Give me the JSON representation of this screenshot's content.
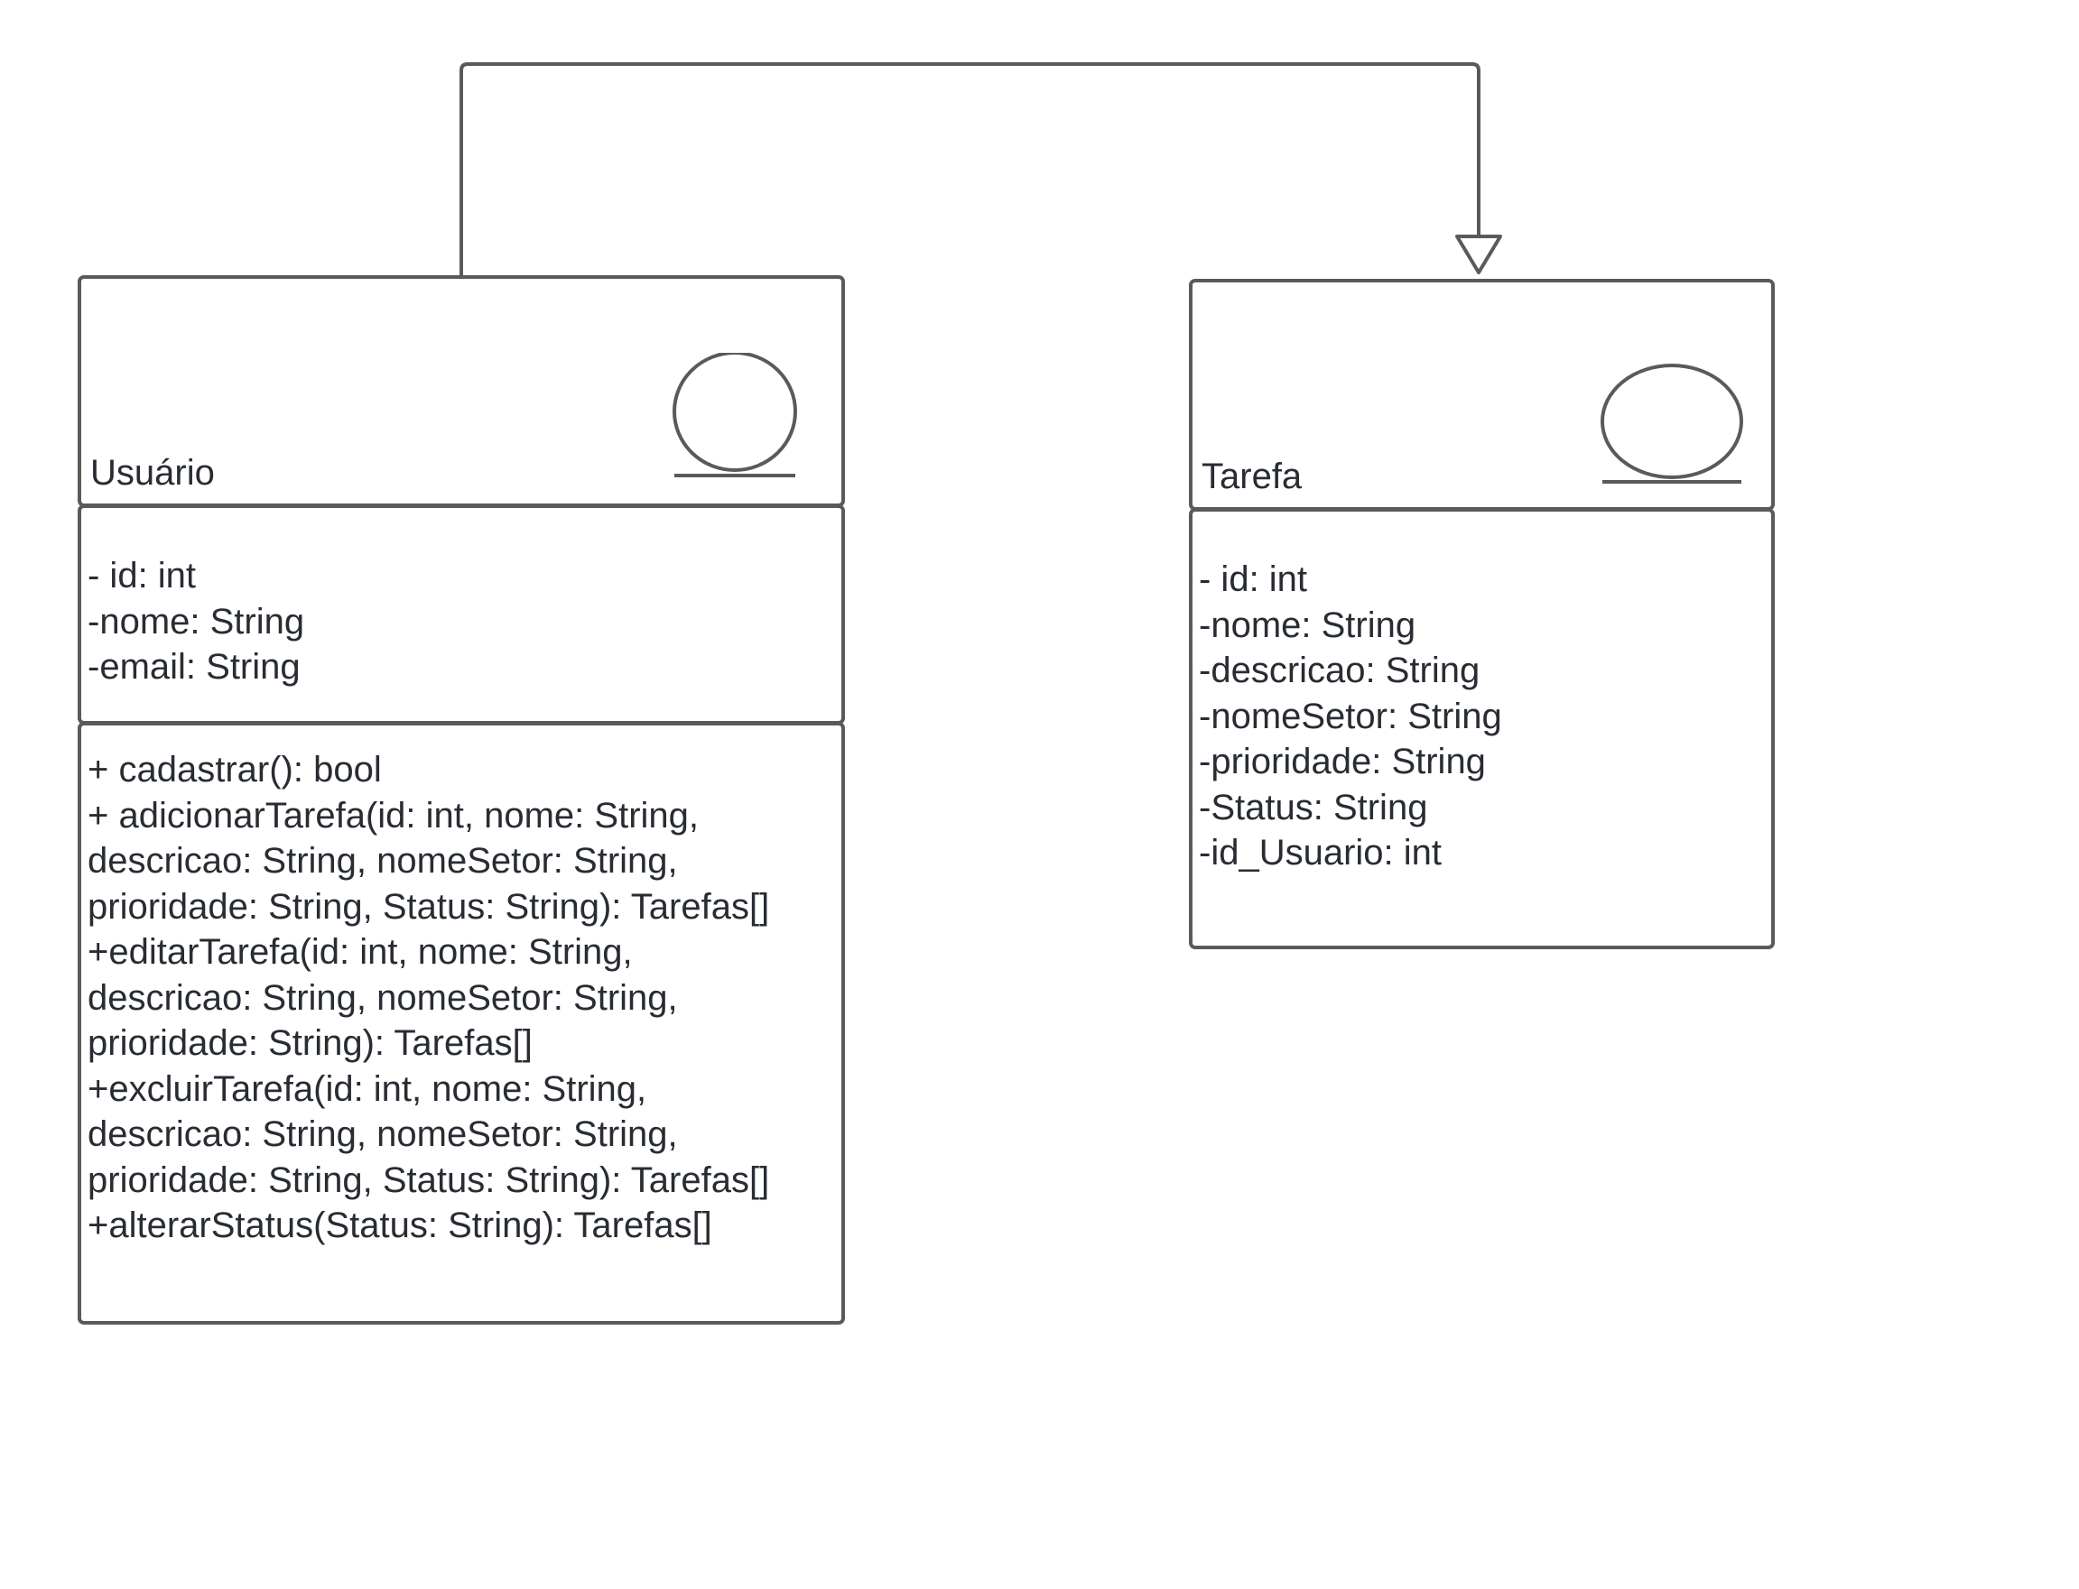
{
  "diagram": {
    "relationship": {
      "type": "generalization",
      "from": "Usuário",
      "to": "Tarefa"
    },
    "classes": {
      "usuario": {
        "name": "Usuário",
        "stereotype_icon": "entity-icon",
        "attributes": [
          "- id: int",
          "-nome: String",
          "-email: String"
        ],
        "methods": [
          "+ cadastrar(): bool",
          "+ adicionarTarefa(id: int, nome: String,",
          "descricao: String, nomeSetor: String,",
          "prioridade: String, Status: String): Tarefas[]",
          "+editarTarefa(id: int, nome: String,",
          "descricao: String, nomeSetor: String,",
          "prioridade: String): Tarefas[]",
          "+excluirTarefa(id: int, nome: String,",
          "descricao: String, nomeSetor: String,",
          "prioridade: String, Status: String): Tarefas[]",
          "+alterarStatus(Status: String): Tarefas[]"
        ]
      },
      "tarefa": {
        "name": "Tarefa",
        "stereotype_icon": "entity-icon",
        "attributes": [
          "- id: int",
          "-nome: String",
          "-descricao: String",
          "-nomeSetor: String",
          "-prioridade: String",
          "-Status: String",
          "-id_Usuario: int"
        ]
      }
    },
    "colors": {
      "stroke": "#5a5a5a",
      "text": "#282c33",
      "background": "#ffffff"
    }
  }
}
